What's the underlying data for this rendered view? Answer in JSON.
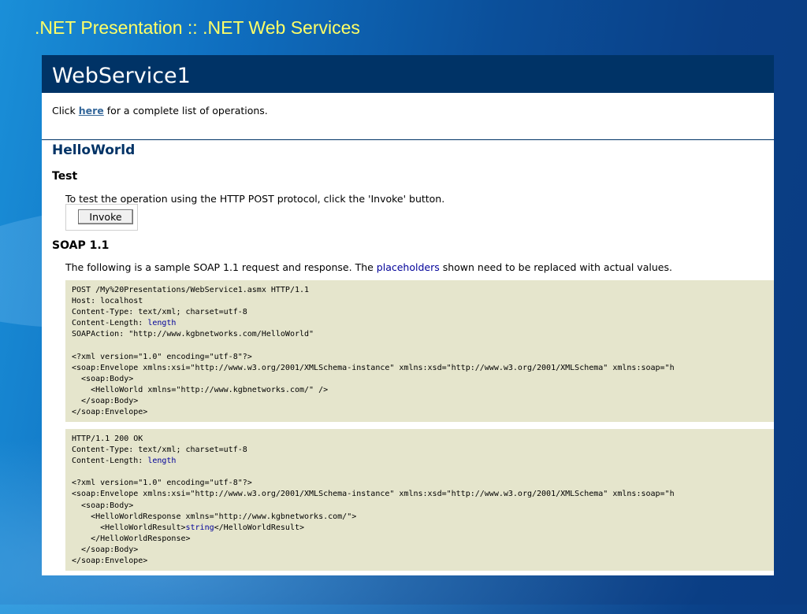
{
  "slide_title": ".NET Presentation :: .NET Web Services",
  "service_name": "WebService1",
  "intro": {
    "prefix": "Click ",
    "link": "here",
    "suffix": " for a complete list of operations."
  },
  "operation": "HelloWorld",
  "test": {
    "heading": "Test",
    "description": "To test the operation using the HTTP POST protocol, click the 'Invoke' button.",
    "button_label": "Invoke"
  },
  "soap": {
    "heading": "SOAP 1.1",
    "desc_before": "The following is a sample SOAP 1.1 request and response. The ",
    "desc_link": "placeholders",
    "desc_after": " shown need to be replaced with actual values."
  },
  "request": {
    "l1": "POST /My%20Presentations/WebService1.asmx HTTP/1.1",
    "l2": "Host: localhost",
    "l3": "Content-Type: text/xml; charset=utf-8",
    "l4_prefix": "Content-Length: ",
    "l4_value": "length",
    "l5": "SOAPAction: \"http://www.kgbnetworks.com/HelloWorld\"",
    "l6": "<?xml version=\"1.0\" encoding=\"utf-8\"?>",
    "l7": "<soap:Envelope xmlns:xsi=\"http://www.w3.org/2001/XMLSchema-instance\" xmlns:xsd=\"http://www.w3.org/2001/XMLSchema\" xmlns:soap=\"h",
    "l8": "  <soap:Body>",
    "l9": "    <HelloWorld xmlns=\"http://www.kgbnetworks.com/\" />",
    "l10": "  </soap:Body>",
    "l11": "</soap:Envelope>"
  },
  "response": {
    "l1": "HTTP/1.1 200 OK",
    "l2": "Content-Type: text/xml; charset=utf-8",
    "l3_prefix": "Content-Length: ",
    "l3_value": "length",
    "l4": "<?xml version=\"1.0\" encoding=\"utf-8\"?>",
    "l5": "<soap:Envelope xmlns:xsi=\"http://www.w3.org/2001/XMLSchema-instance\" xmlns:xsd=\"http://www.w3.org/2001/XMLSchema\" xmlns:soap=\"h",
    "l6": "  <soap:Body>",
    "l7": "    <HelloWorldResponse xmlns=\"http://www.kgbnetworks.com/\">",
    "l8_prefix": "      <HelloWorldResult>",
    "l8_value": "string",
    "l8_suffix": "</HelloWorldResult>",
    "l9": "    </HelloWorldResponse>",
    "l10": "  </soap:Body>",
    "l11": "</soap:Envelope>"
  },
  "colors": {
    "header_bg": "#003366",
    "title_yellow": "#ffff66",
    "code_bg": "#e5e5cc",
    "link": "#336699",
    "placeholder": "#000099"
  }
}
